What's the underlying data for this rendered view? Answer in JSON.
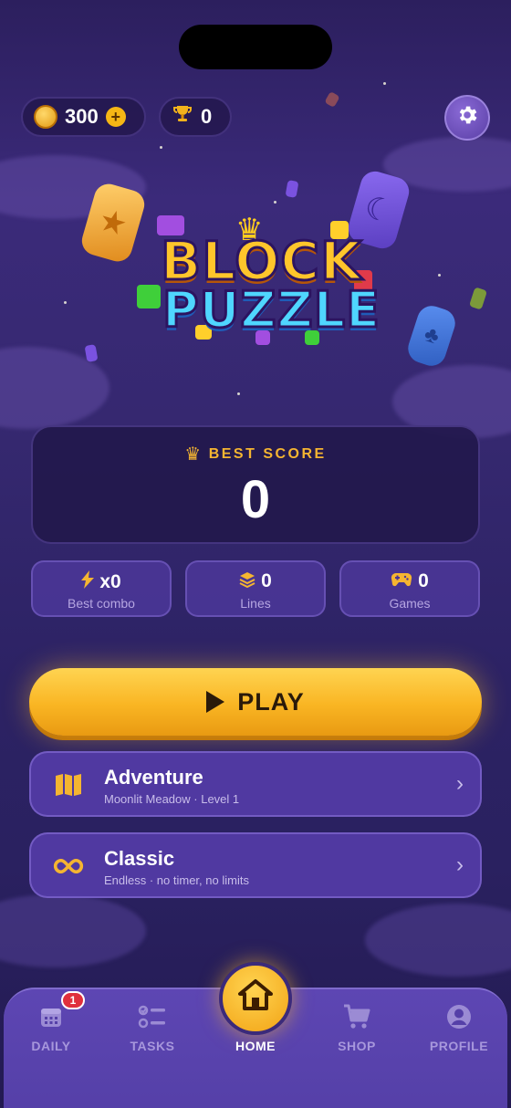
{
  "colors": {
    "accent": "#f5b531",
    "background": "#35286f",
    "card": "#221850",
    "tabbar": "#5540a8"
  },
  "header": {
    "coins": "300",
    "coin_icon": "coin-icon",
    "add_icon": "plus-icon",
    "trophies": "0",
    "trophy_icon": "trophy-icon",
    "settings_icon": "gear-icon"
  },
  "logo": {
    "line1": "BLOCK",
    "line2": "PUZZLE"
  },
  "best_score": {
    "label": "BEST SCORE",
    "value": "0"
  },
  "stats": [
    {
      "icon": "lightning-icon",
      "value": "x0",
      "label": "Best combo"
    },
    {
      "icon": "layers-icon",
      "value": "0",
      "label": "Lines"
    },
    {
      "icon": "gamepad-icon",
      "value": "0",
      "label": "Games"
    }
  ],
  "play": {
    "label": "PLAY"
  },
  "modes": [
    {
      "icon": "map-icon",
      "title": "Adventure",
      "subtitle": "Moonlit Meadow · Level 1"
    },
    {
      "icon": "infinity-icon",
      "title": "Classic",
      "subtitle": "Endless · no timer, no limits"
    }
  ],
  "tabs": [
    {
      "icon": "calendar-icon",
      "label": "DAILY",
      "badge": "1"
    },
    {
      "icon": "tasks-icon",
      "label": "TASKS"
    },
    {
      "icon": "home-icon",
      "label": "HOME",
      "active": true
    },
    {
      "icon": "cart-icon",
      "label": "SHOP"
    },
    {
      "icon": "profile-icon",
      "label": "PROFILE"
    }
  ]
}
